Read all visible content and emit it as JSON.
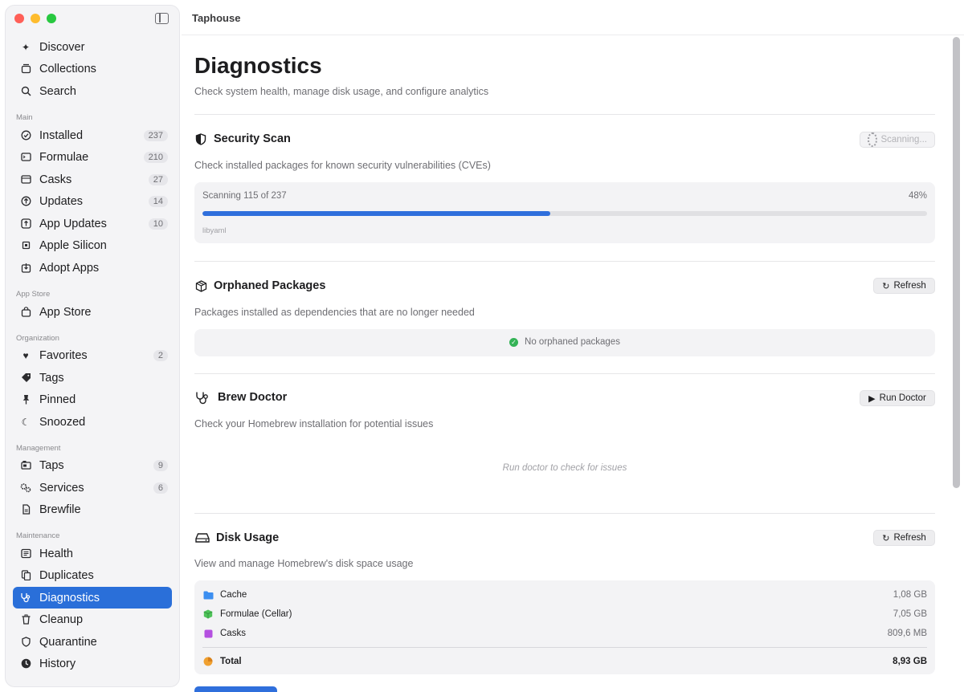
{
  "app": {
    "title": "Taphouse"
  },
  "sidebar": {
    "top": [
      {
        "label": "Discover",
        "icon": "sparkle-icon"
      },
      {
        "label": "Collections",
        "icon": "collections-icon"
      },
      {
        "label": "Search",
        "icon": "search-icon"
      }
    ],
    "sections": {
      "main": "Main",
      "app_store": "App Store",
      "organization": "Organization",
      "management": "Management",
      "maintenance": "Maintenance"
    },
    "main": [
      {
        "label": "Installed",
        "badge": "237",
        "icon": "checkmark-circle-icon"
      },
      {
        "label": "Formulae",
        "badge": "210",
        "icon": "terminal-icon"
      },
      {
        "label": "Casks",
        "badge": "27",
        "icon": "window-icon"
      },
      {
        "label": "Updates",
        "badge": "14",
        "icon": "arrow-up-circle-icon"
      },
      {
        "label": "App Updates",
        "badge": "10",
        "icon": "app-update-icon"
      },
      {
        "label": "Apple Silicon",
        "icon": "cpu-icon"
      },
      {
        "label": "Adopt Apps",
        "icon": "download-box-icon"
      }
    ],
    "app_store": [
      {
        "label": "App Store",
        "icon": "bag-icon"
      }
    ],
    "organization": [
      {
        "label": "Favorites",
        "badge": "2",
        "icon": "heart-icon"
      },
      {
        "label": "Tags",
        "icon": "tag-icon"
      },
      {
        "label": "Pinned",
        "icon": "pin-icon"
      },
      {
        "label": "Snoozed",
        "icon": "moon-icon"
      }
    ],
    "management": [
      {
        "label": "Taps",
        "badge": "9",
        "icon": "tap-icon"
      },
      {
        "label": "Services",
        "badge": "6",
        "icon": "gears-icon"
      },
      {
        "label": "Brewfile",
        "icon": "document-icon"
      }
    ],
    "maintenance": [
      {
        "label": "Health",
        "icon": "health-icon"
      },
      {
        "label": "Duplicates",
        "icon": "duplicate-icon"
      },
      {
        "label": "Diagnostics",
        "icon": "stethoscope-icon",
        "active": true
      },
      {
        "label": "Cleanup",
        "icon": "trash-icon"
      },
      {
        "label": "Quarantine",
        "icon": "shield-icon"
      },
      {
        "label": "History",
        "icon": "clock-icon"
      }
    ]
  },
  "main": {
    "title": "Diagnostics",
    "subtitle": "Check system health, manage disk usage, and configure analytics",
    "security": {
      "title": "Security Scan",
      "description": "Check installed packages for known security vulnerabilities (CVEs)",
      "button": "Scanning...",
      "status": "Scanning 115 of 237",
      "percent_label": "48%",
      "progress": 0.48,
      "current": "libyaml"
    },
    "orphaned": {
      "title": "Orphaned Packages",
      "description": "Packages installed as dependencies that are no longer needed",
      "button": "Refresh",
      "message": "No orphaned packages"
    },
    "doctor": {
      "title": "Brew Doctor",
      "description": "Check your Homebrew installation for potential issues",
      "button": "Run Doctor",
      "empty": "Run doctor to check for issues"
    },
    "disk": {
      "title": "Disk Usage",
      "description": "View and manage Homebrew's disk space usage",
      "button": "Refresh",
      "rows": [
        {
          "name": "Cache",
          "size": "1,08 GB",
          "color": "#3b8ef0"
        },
        {
          "name": "Formulae (Cellar)",
          "size": "7,05 GB",
          "color": "#4fc35a"
        },
        {
          "name": "Casks",
          "size": "809,6 MB",
          "color": "#b450e0"
        }
      ],
      "total": {
        "name": "Total",
        "size": "8,93 GB",
        "color": "#f0a030"
      }
    }
  },
  "colors": {
    "accent": "#2a6fd9",
    "progress": "#2f6fdc",
    "success": "#34b356"
  }
}
